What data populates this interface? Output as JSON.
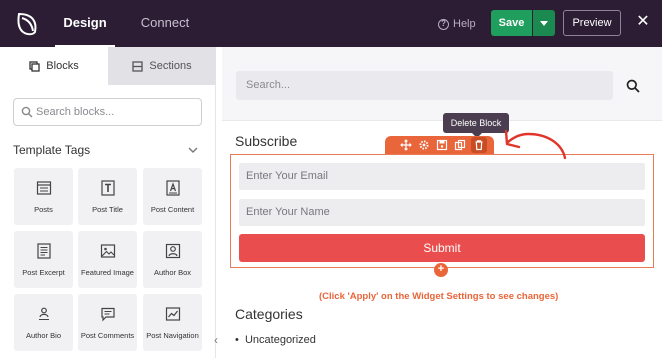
{
  "topbar": {
    "logo_icon": "leaf-logo-icon",
    "tabs": [
      {
        "label": "Design",
        "active": true
      },
      {
        "label": "Connect",
        "active": false
      }
    ],
    "help_label": "Help",
    "save_label": "Save",
    "preview_label": "Preview",
    "close_icon": "close-icon",
    "colors": {
      "bar": "#2c1d34",
      "save": "#1f9e5e"
    }
  },
  "sidebar": {
    "tabs": [
      {
        "label": "Blocks",
        "icon": "blocks-icon",
        "active": true
      },
      {
        "label": "Sections",
        "icon": "sections-icon",
        "active": false
      }
    ],
    "search": {
      "placeholder": "Search blocks..."
    },
    "group_title": "Template Tags",
    "blocks": [
      {
        "label": "Posts",
        "icon": "posts-icon"
      },
      {
        "label": "Post Title",
        "icon": "post-title-icon"
      },
      {
        "label": "Post Content",
        "icon": "post-content-icon"
      },
      {
        "label": "Post Excerpt",
        "icon": "post-excerpt-icon"
      },
      {
        "label": "Featured Image",
        "icon": "featured-image-icon"
      },
      {
        "label": "Author Box",
        "icon": "author-box-icon"
      },
      {
        "label": "Author Bio",
        "icon": "author-bio-icon"
      },
      {
        "label": "Post Comments",
        "icon": "post-comments-icon"
      },
      {
        "label": "Post Navigation",
        "icon": "post-navigation-icon"
      }
    ]
  },
  "main": {
    "search": {
      "placeholder": "Search..."
    },
    "subscribe_heading": "Subscribe",
    "tooltip": "Delete Block",
    "toolbar_icons": [
      "move-icon",
      "settings-icon",
      "save-icon",
      "duplicate-icon",
      "trash-icon"
    ],
    "form": {
      "email_placeholder": "Enter Your Email",
      "name_placeholder": "Enter Your Name",
      "submit_label": "Submit"
    },
    "note": "(Click 'Apply' on the Widget Settings to see changes)",
    "categories_heading": "Categories",
    "categories": [
      "Uncategorized"
    ],
    "colors": {
      "accent": "#e9653a",
      "submit": "#e94d4d",
      "annotation": "#e0352b"
    }
  }
}
